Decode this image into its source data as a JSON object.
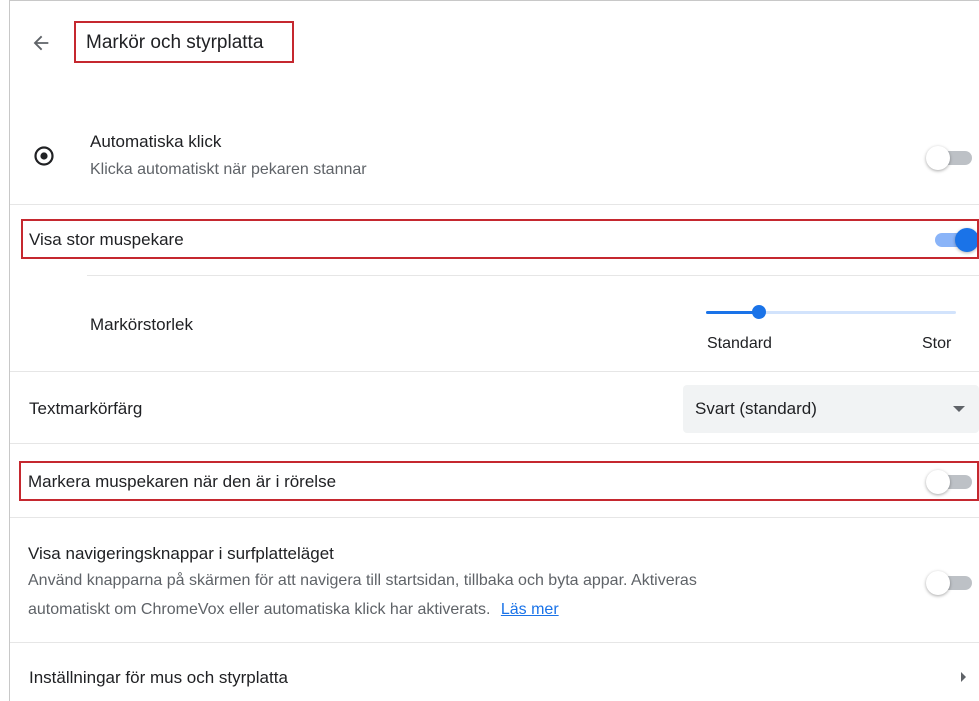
{
  "header": {
    "title": "Markör och styrplatta",
    "back_icon": "arrow-left-icon"
  },
  "auto_click": {
    "icon": "target-icon",
    "title": "Automatiska klick",
    "subtitle": "Klicka automatiskt när pekaren stannar",
    "enabled": false
  },
  "large_cursor": {
    "title": "Visa stor muspekare",
    "enabled": true
  },
  "cursor_size": {
    "title": "Markörstorlek",
    "min_label": "Standard",
    "max_label": "Stor",
    "value_fraction": 0.21
  },
  "text_cursor_color": {
    "title": "Textmarkörfärg",
    "selected": "Svart (standard)"
  },
  "highlight_cursor": {
    "title": "Markera muspekaren när den är i rörelse",
    "enabled": false
  },
  "tablet_nav_buttons": {
    "title": "Visa navigeringsknappar i surfplatteläget",
    "subtitle_line1": "Använd knapparna på skärmen för att navigera till startsidan, tillbaka och byta appar. Aktiveras",
    "subtitle_line2": "automatiskt om ChromeVox eller automatiska klick har aktiverats.",
    "link_text": "Läs mer",
    "enabled": false
  },
  "mouse_touchpad_settings": {
    "title": "Inställningar för mus och styrplatta"
  },
  "colors": {
    "accent": "#1a73e8",
    "highlight_border": "#c5282f"
  }
}
